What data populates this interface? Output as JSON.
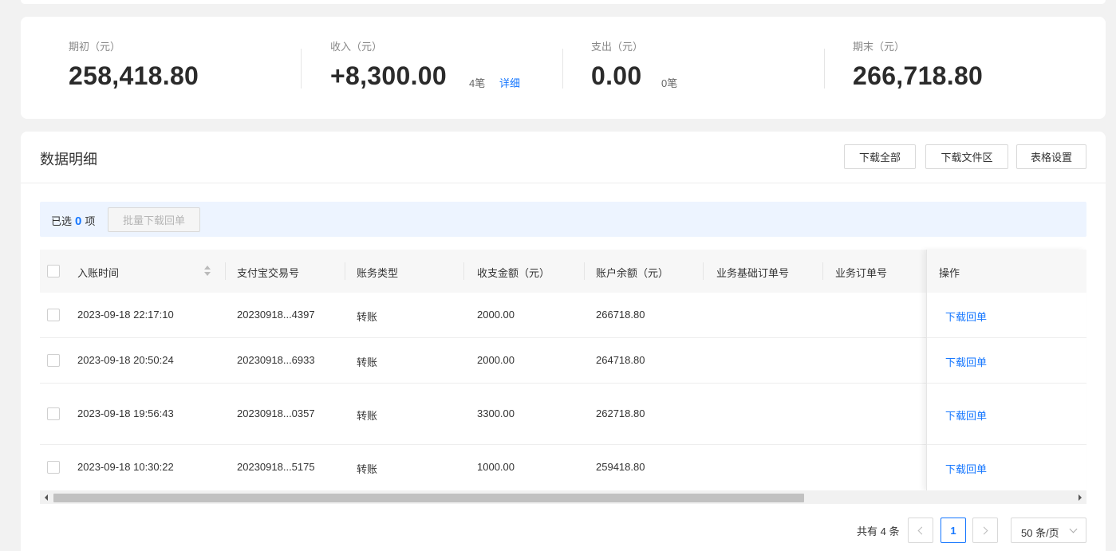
{
  "summary": {
    "opening": {
      "label": "期初（元）",
      "value": "258,418.80"
    },
    "income": {
      "label": "收入（元）",
      "value": "+8,300.00",
      "count": "4笔",
      "link": "详细"
    },
    "expense": {
      "label": "支出（元）",
      "value": "0.00",
      "count": "0笔"
    },
    "closing": {
      "label": "期末（元）",
      "value": "266,718.80"
    }
  },
  "detail": {
    "title": "数据明细",
    "buttons": {
      "download_all": "下载全部",
      "download_area": "下载文件区",
      "table_settings": "表格设置"
    }
  },
  "selection": {
    "prefix": "已选",
    "count": "0",
    "suffix": "项",
    "batch_button": "批量下载回单"
  },
  "table": {
    "columns": [
      "入账时间",
      "支付宝交易号",
      "账务类型",
      "收支金额（元）",
      "账户余额（元）",
      "业务基础订单号",
      "业务订单号",
      "操作"
    ],
    "rows": [
      {
        "time": "2023-09-18 22:17:10",
        "trade_no": "20230918...4397",
        "type": "转账",
        "amount": "2000.00",
        "balance": "266718.80",
        "base_order": "",
        "order": "",
        "action": "下载回单"
      },
      {
        "time": "2023-09-18 20:50:24",
        "trade_no": "20230918...6933",
        "type": "转账",
        "amount": "2000.00",
        "balance": "264718.80",
        "base_order": "",
        "order": "",
        "action": "下载回单"
      },
      {
        "time": "2023-09-18 19:56:43",
        "trade_no": "20230918...0357",
        "type": "转账",
        "amount": "3300.00",
        "balance": "262718.80",
        "base_order": "",
        "order": "",
        "action": "下载回单"
      },
      {
        "time": "2023-09-18 10:30:22",
        "trade_no": "20230918...5175",
        "type": "转账",
        "amount": "1000.00",
        "balance": "259418.80",
        "base_order": "",
        "order": "",
        "action": "下载回单"
      }
    ]
  },
  "pagination": {
    "total": "共有 4 条",
    "current_page": "1",
    "page_size": "50 条/页"
  },
  "colors": {
    "accent": "#1677ff",
    "selection_bar": "#edf4ff"
  }
}
